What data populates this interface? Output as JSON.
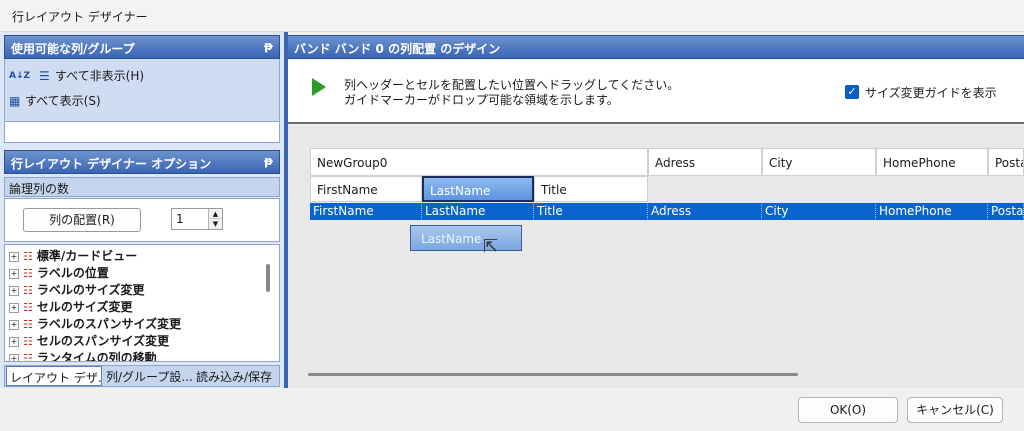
{
  "window": {
    "title": "行レイアウト デザイナー"
  },
  "left": {
    "pane1": {
      "title": "使用可能な列/グループ",
      "pin": "ᵽ",
      "sort_icon": "A↓Z",
      "hide_all": "すべて非表示(H)",
      "show_all": "すべて表示(S)"
    },
    "pane2": {
      "title": "行レイアウト デザイナー オプション",
      "pin": "ᵽ",
      "section_label": "論理列の数",
      "arrange_button": "列の配置(R)",
      "spin_value": "1"
    },
    "tree": [
      {
        "label": "標準/カードビュー"
      },
      {
        "label": "ラベルの位置"
      },
      {
        "label": "ラベルのサイズ変更"
      },
      {
        "label": "セルのサイズ変更"
      },
      {
        "label": "ラベルのスパンサイズ変更"
      },
      {
        "label": "セルのスパンサイズ変更"
      },
      {
        "label": "ランタイムの列の移動"
      }
    ],
    "tabs": [
      {
        "label": "レイアウト デザ..."
      },
      {
        "label": "列/グループ設..."
      },
      {
        "label": "読み込み/保存"
      }
    ]
  },
  "right": {
    "title": "バンド バンド 0 の列配置 のデザイン",
    "instruction_line1": "列ヘッダーとセルを配置したい位置へドラッグしてください。",
    "instruction_line2": "ガイドマーカーがドロップ可能な領域を示します。",
    "checkbox_label": "サイズ変更ガイドを表示",
    "checkbox_checked": true,
    "group_header": "NewGroup0",
    "headers": [
      "Adress",
      "City",
      "HomePhone",
      "Posta"
    ],
    "sub_headers": [
      "FirstName",
      "LastName",
      "Title"
    ],
    "data_row": [
      "FirstName",
      "LastName",
      "Title",
      "Adress",
      "City",
      "HomePhone",
      "Posta"
    ],
    "drag_ghost": "LastName"
  },
  "footer": {
    "ok": "OK(O)",
    "cancel": "キャンセル(C)"
  },
  "colors": {
    "header_blue": "#3a65b3",
    "selection_blue": "#0a64d0",
    "play_green": "#2c9a2c"
  }
}
